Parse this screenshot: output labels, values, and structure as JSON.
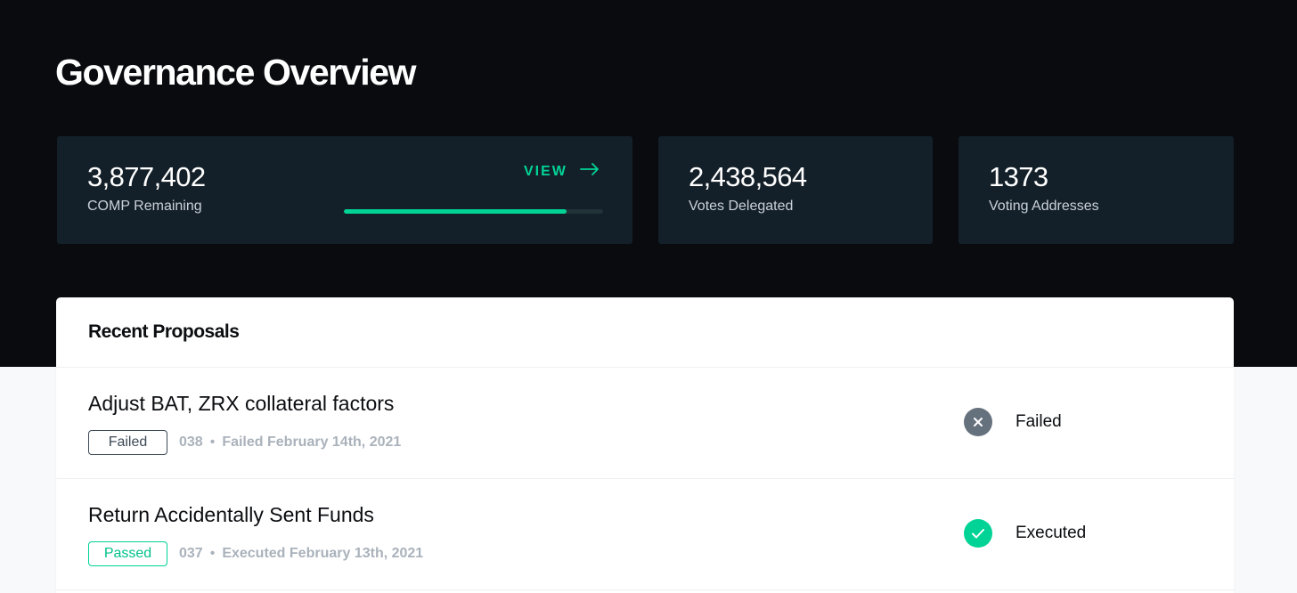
{
  "page": {
    "title": "Governance Overview"
  },
  "stats": {
    "comp_remaining": {
      "value": "3,877,402",
      "label": "COMP Remaining",
      "view_label": "VIEW",
      "progress_fraction": 0.86
    },
    "votes_delegated": {
      "value": "2,438,564",
      "label": "Votes Delegated"
    },
    "voting_addresses": {
      "value": "1373",
      "label": "Voting Addresses"
    }
  },
  "proposals": {
    "title": "Recent Proposals",
    "items": [
      {
        "title": "Adjust BAT, ZRX collateral factors",
        "badge": "Failed",
        "id": "038",
        "separator": "•",
        "meta": "Failed February 14th, 2021",
        "state": "Failed",
        "state_icon": "x-circle-icon"
      },
      {
        "title": "Return Accidentally Sent Funds",
        "badge": "Passed",
        "id": "037",
        "separator": "•",
        "meta": "Executed February 13th, 2021",
        "state": "Executed",
        "state_icon": "check-circle-icon"
      }
    ]
  },
  "colors": {
    "accent": "#00d395",
    "hero_bg": "#090b0f",
    "card_bg": "#142029",
    "failed_gray": "#66717e"
  }
}
